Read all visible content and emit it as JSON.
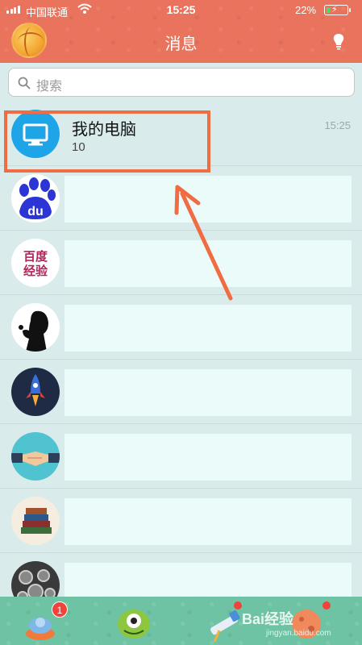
{
  "status_bar": {
    "carrier": "中国联通",
    "time": "15:25",
    "battery_percent": "22%",
    "battery_level": 0.22,
    "battery_color": "#4cd964"
  },
  "header": {
    "title": "消息",
    "avatar_icon": "basketball-avatar-icon",
    "action_icon": "lightbulb-icon",
    "background_color": "#e9735c"
  },
  "search": {
    "placeholder": "搜索"
  },
  "conversations": [
    {
      "title": "我的电脑",
      "subtitle": "10",
      "time": "15:25",
      "avatar": "monitor-icon",
      "highlighted": true
    },
    {
      "avatar": "baidu-icon",
      "avatar_text": "du"
    },
    {
      "avatar": "baidu-jingyan-icon",
      "avatar_text_line1": "百度",
      "avatar_text_line2": "经验"
    },
    {
      "avatar": "silhouette-avatar"
    },
    {
      "avatar": "rocket-avatar"
    },
    {
      "avatar": "handshake-avatar"
    },
    {
      "avatar": "books-avatar"
    },
    {
      "avatar": "gears-avatar"
    }
  ],
  "annotation": {
    "color": "#f06d44"
  },
  "tabbar": {
    "tabs": [
      {
        "name": "messages-tab",
        "icon": "ufo-icon",
        "badge": "1"
      },
      {
        "name": "contacts-tab",
        "icon": "monster-icon"
      },
      {
        "name": "dynamic-tab",
        "icon": "telescope-icon",
        "dot": true
      },
      {
        "name": "profile-tab",
        "icon": "planet-icon",
        "dot": true
      }
    ],
    "background_color": "#6dc3a3"
  },
  "watermark": {
    "brand": "Bai",
    "brand_suffix": "经验",
    "url": "jingyan.baidu.com"
  }
}
